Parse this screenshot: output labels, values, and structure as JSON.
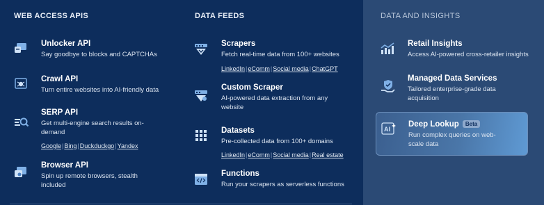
{
  "web_access": {
    "heading": "WEB ACCESS APIS",
    "items": [
      {
        "title": "Unlocker API",
        "desc": "Say goodbye to blocks and CAPTCHAs",
        "icon": "unlock-icon"
      },
      {
        "title": "Crawl API",
        "desc": "Turn entire websites into AI-friendly data",
        "icon": "crawl-bug-icon"
      },
      {
        "title": "SERP API",
        "desc": "Get multi-engine search results on-demand",
        "icon": "search-results-icon",
        "links": [
          "Google",
          "Bing",
          "Duckduckgo",
          "Yandex"
        ]
      },
      {
        "title": "Browser API",
        "desc": "Spin up remote browsers, stealth included",
        "icon": "browser-icon"
      }
    ]
  },
  "data_feeds": {
    "heading": "DATA FEEDS",
    "items": [
      {
        "title": "Scrapers",
        "desc": "Fetch real-time data from 100+ websites",
        "icon": "scraper-icon",
        "links": [
          "LinkedIn",
          "eComm",
          "Social media",
          "ChatGPT"
        ]
      },
      {
        "title": "Custom Scraper",
        "desc": "AI-powered data extraction from any website",
        "icon": "custom-scraper-icon"
      },
      {
        "title": "Datasets",
        "desc": "Pre-collected data from 100+ domains",
        "icon": "grid-dataset-icon",
        "links": [
          "LinkedIn",
          "eComm",
          "Social media",
          "Real estate"
        ]
      },
      {
        "title": "Functions",
        "desc": "Run your scrapers as serverless functions",
        "icon": "code-functions-icon"
      }
    ]
  },
  "insights": {
    "heading": "DATA AND INSIGHTS",
    "items": [
      {
        "title": "Retail Insights",
        "desc": "Access AI-powered cross-retailer insights",
        "icon": "chart-insights-icon"
      },
      {
        "title": "Managed Data Services",
        "desc": "Tailored enterprise-grade data acquisition",
        "icon": "hand-shield-icon"
      },
      {
        "title": "Deep Lookup",
        "badge": "Beta",
        "desc": "Run complex queries on web-scale data",
        "icon": "ai-lookup-icon"
      }
    ]
  }
}
